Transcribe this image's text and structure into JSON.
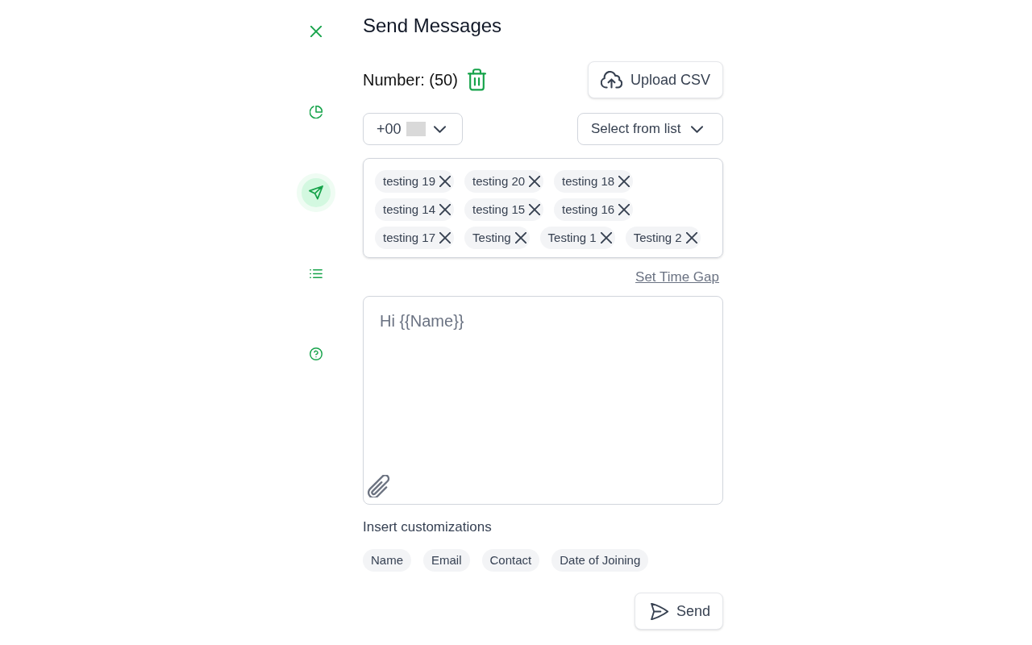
{
  "sidebar": {
    "items": [
      {
        "selected": false
      },
      {
        "selected": true
      },
      {
        "selected": false
      },
      {
        "selected": false
      }
    ]
  },
  "header": {
    "title": "Send Messages"
  },
  "recipients": {
    "count_label": "Number: (50)",
    "upload_button": "Upload CSV",
    "country_code": "+00",
    "list_select": "Select from list",
    "tags": [
      {
        "label": "testing 19"
      },
      {
        "label": "testing 20"
      },
      {
        "label": "testing 18"
      },
      {
        "label": "testing 14"
      },
      {
        "label": "testing 15"
      },
      {
        "label": "testing 16"
      },
      {
        "label": "testing 17"
      },
      {
        "label": "Testing"
      },
      {
        "label": "Testing 1"
      },
      {
        "label": "Testing 2"
      }
    ]
  },
  "time_gap_link": "Set Time Gap",
  "message": {
    "placeholder": "Hi {{Name}}"
  },
  "customizations": {
    "label": "Insert customizations",
    "chips": [
      "Name",
      "Email",
      "Contact",
      "Date of Joining"
    ]
  },
  "send_button": "Send"
}
